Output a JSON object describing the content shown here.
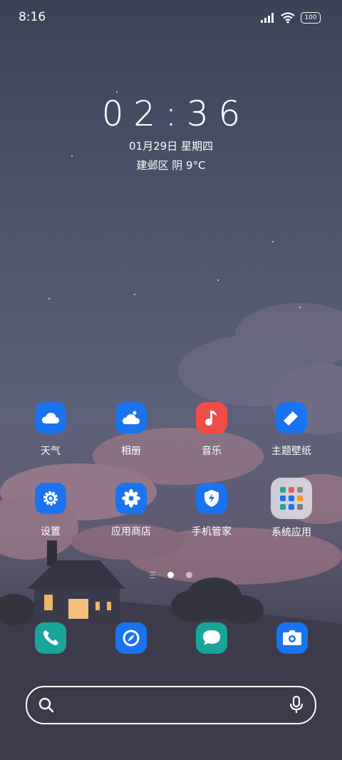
{
  "status_bar": {
    "time": "8:16",
    "battery": "100"
  },
  "clock": {
    "time": "02:36",
    "date": "01月29日 星期四",
    "weather": "建邺区 阴 9°C"
  },
  "apps": [
    {
      "label": "天气",
      "icon": "weather-icon",
      "color": "#1a73f0"
    },
    {
      "label": "相册",
      "icon": "gallery-icon",
      "color": "#1a73f0"
    },
    {
      "label": "音乐",
      "icon": "music-icon",
      "color": "#f14c47"
    },
    {
      "label": "主题壁纸",
      "icon": "theme-brush-icon",
      "color": "#1a73f0"
    },
    {
      "label": "设置",
      "icon": "settings-gear-icon",
      "color": "#1a73f0"
    },
    {
      "label": "应用商店",
      "icon": "app-store-icon",
      "color": "#1a73f0"
    },
    {
      "label": "手机管家",
      "icon": "security-shield-icon",
      "color": "#1a73f0"
    },
    {
      "label": "系统应用",
      "icon": "folder-icon",
      "color": "#e1e1e6"
    }
  ],
  "dock": [
    {
      "icon": "phone-icon",
      "color": "#19a59c"
    },
    {
      "icon": "browser-compass-icon",
      "color": "#1a73f0"
    },
    {
      "icon": "messages-icon",
      "color": "#19a59c"
    },
    {
      "icon": "camera-icon",
      "color": "#1a73f0"
    }
  ],
  "page_indicator": {
    "pages": 2,
    "current": 1
  },
  "search": {
    "value": "",
    "placeholder": ""
  }
}
